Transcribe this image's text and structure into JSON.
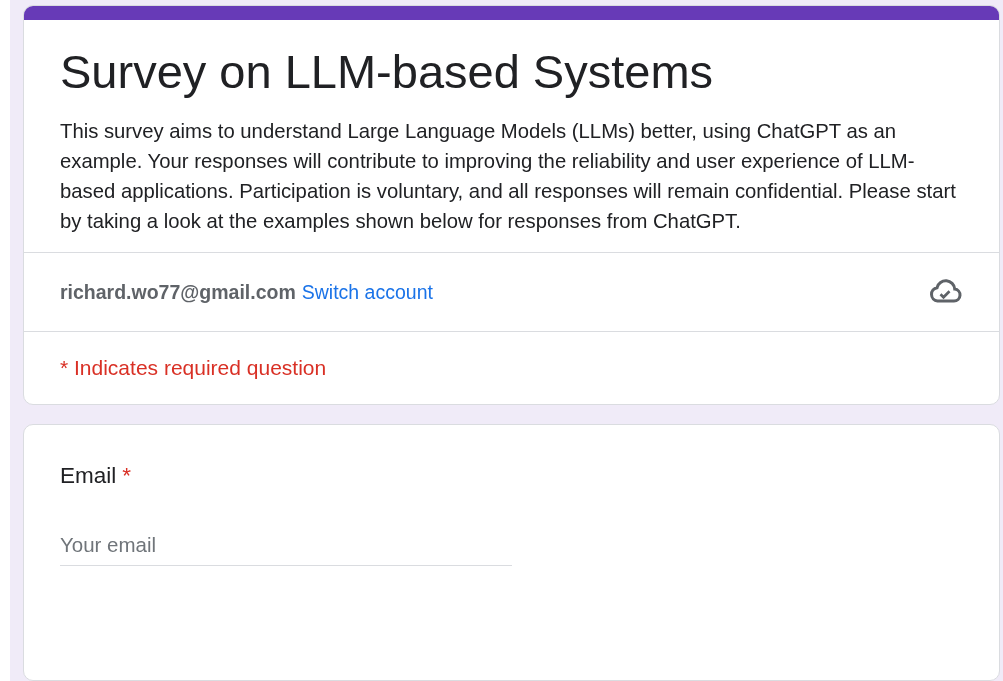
{
  "form": {
    "title": "Survey on LLM-based Systems",
    "description": "This survey aims to understand Large Language Models (LLMs) better, using ChatGPT as an example. Your responses will contribute to improving the reliability and user experience of LLM-based applications. Participation is voluntary, and all responses will remain confidential. Please start by taking a look at the examples shown below for responses from ChatGPT.",
    "account": {
      "email": "richard.wo77@gmail.com",
      "switch_link": "Switch account"
    },
    "required_note": "* Indicates required question"
  },
  "questions": [
    {
      "kind": "text",
      "label": "Email",
      "required": true,
      "required_mark": "*",
      "placeholder": "Your email"
    }
  ]
}
